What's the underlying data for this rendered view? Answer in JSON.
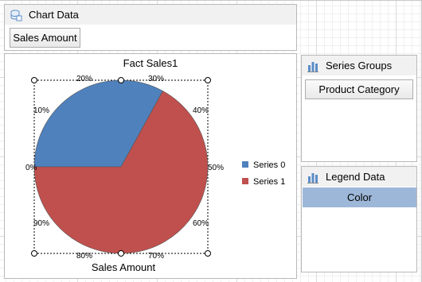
{
  "chart_data_panel": {
    "title": "Chart Data",
    "item": "Sales Amount"
  },
  "series_groups_panel": {
    "title": "Series Groups",
    "item": "Product Category"
  },
  "legend_data_panel": {
    "title": "Legend Data",
    "item": "Color"
  },
  "colors": {
    "series0": "#4f81bd",
    "series1": "#c0504d",
    "selected_chip": "#9db7d8"
  },
  "chart_data": {
    "type": "pie",
    "title": "Fact Sales1",
    "xlabel": "Sales Amount",
    "series": [
      {
        "name": "Series 0",
        "value": 0.33,
        "color": "#4f81bd"
      },
      {
        "name": "Series 1",
        "value": 0.67,
        "color": "#c0504d"
      }
    ],
    "percent_labels": [
      "0%",
      "10%",
      "20%",
      "30%",
      "40%",
      "50%",
      "60%",
      "70%",
      "80%",
      "90%"
    ],
    "legend_position": "right"
  }
}
